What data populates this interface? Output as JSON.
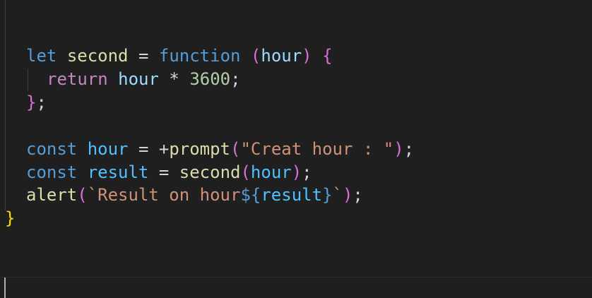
{
  "code": {
    "line1": {
      "kw_let": "let",
      "name": "second",
      "eq": "=",
      "kw_function": "function",
      "paren_open": "(",
      "param": "hour",
      "paren_close": ")",
      "brace_open": "{"
    },
    "line2": {
      "kw_return": "return",
      "var": "hour",
      "op": "*",
      "num": "3600",
      "semi": ";"
    },
    "line3": {
      "brace_close": "}",
      "semi": ";"
    },
    "line5": {
      "kw_const": "const",
      "name": "hour",
      "eq": "=",
      "plus": "+",
      "fn": "prompt",
      "paren_open": "(",
      "str": "\"Creat hour : \"",
      "paren_close": ")",
      "semi": ";"
    },
    "line6": {
      "kw_const": "const",
      "name": "result",
      "eq": "=",
      "fn": "second",
      "paren_open": "(",
      "arg": "hour",
      "paren_close": ")",
      "semi": ";"
    },
    "line7": {
      "fn": "alert",
      "paren_open": "(",
      "tpl_start": "`Result on hour",
      "interp_open": "${",
      "interp_var": "result",
      "interp_close": "}",
      "tpl_end": "`",
      "paren_close": ")",
      "semi": ";"
    },
    "line8": {
      "brace_close": "}"
    }
  },
  "colors": {
    "background": "#1f1f1f",
    "keyword": "#569cd6",
    "control_keyword": "#c586c0",
    "variable": "#9cdcfe",
    "constant": "#4fc1ff",
    "function": "#dcdcaa",
    "number": "#b5cea8",
    "string": "#ce9178"
  }
}
